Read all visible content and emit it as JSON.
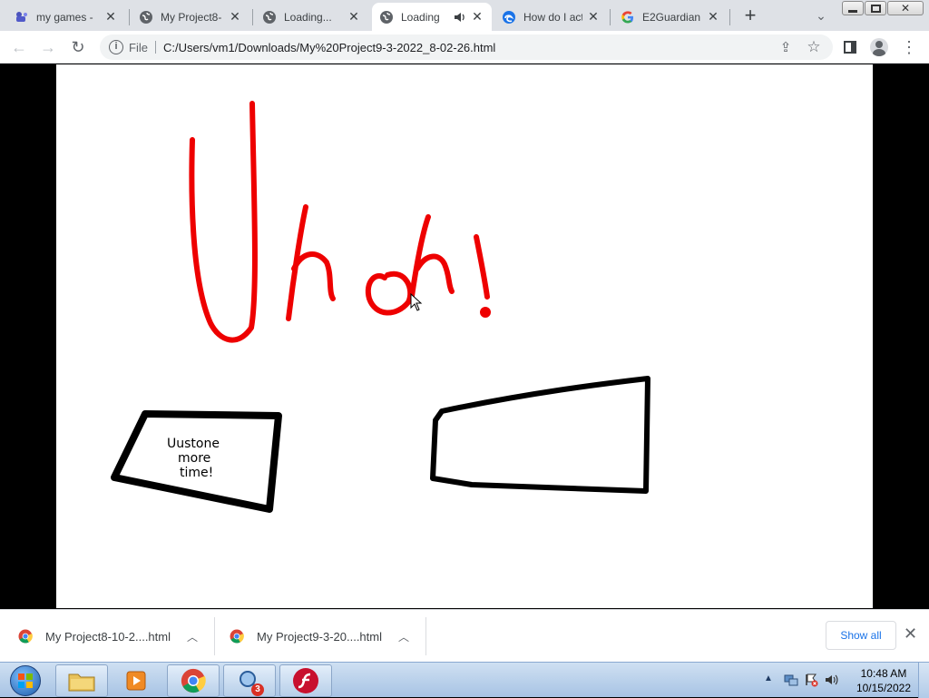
{
  "tabs": [
    {
      "title": "my games - ",
      "active": false
    },
    {
      "title": "My Project8-",
      "active": false
    },
    {
      "title": "Loading...",
      "active": false
    },
    {
      "title": "Loading",
      "active": true
    },
    {
      "title": "How do I act",
      "active": false
    },
    {
      "title": "E2Guardian -",
      "active": false
    }
  ],
  "toolbar": {
    "file_label": "File",
    "url": "C:/Users/vm1/Downloads/My%20Project9-3-2022_8-02-26.html"
  },
  "drawing": {
    "main_text": "Uhoh!",
    "left_bubble_text": "Uustone more time!",
    "main_color": "#ee0000"
  },
  "downloads": {
    "items": [
      "My Project8-10-2....html",
      "My Project9-3-20....html"
    ],
    "show_all": "Show all"
  },
  "taskbar": {
    "time": "10:48 AM",
    "date": "10/15/2022",
    "badge": "3"
  }
}
